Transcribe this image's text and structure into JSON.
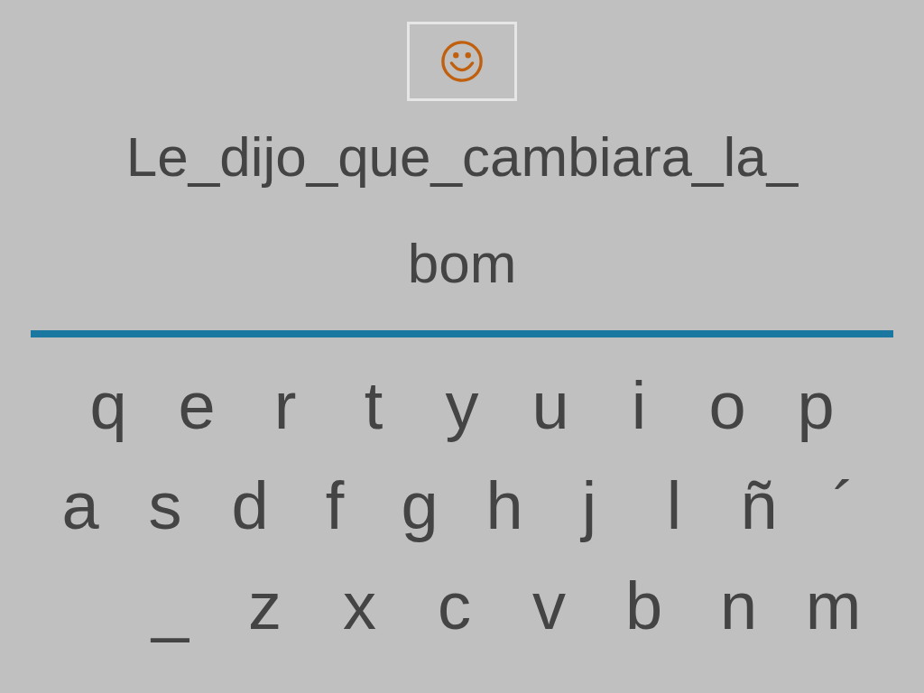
{
  "hint_button": {
    "kind": "smiley"
  },
  "clue": "Le_dijo_que_cambiara_la_",
  "answer": "bom",
  "keyboard": [
    [
      "q",
      "e",
      "r",
      "t",
      "y",
      "u",
      "i",
      "o",
      "p"
    ],
    [
      "a",
      "s",
      "d",
      "f",
      "g",
      "h",
      "j",
      "l",
      "ñ",
      "´"
    ],
    [
      "_",
      "z",
      "x",
      "c",
      "v",
      "b",
      "n",
      "m"
    ]
  ]
}
